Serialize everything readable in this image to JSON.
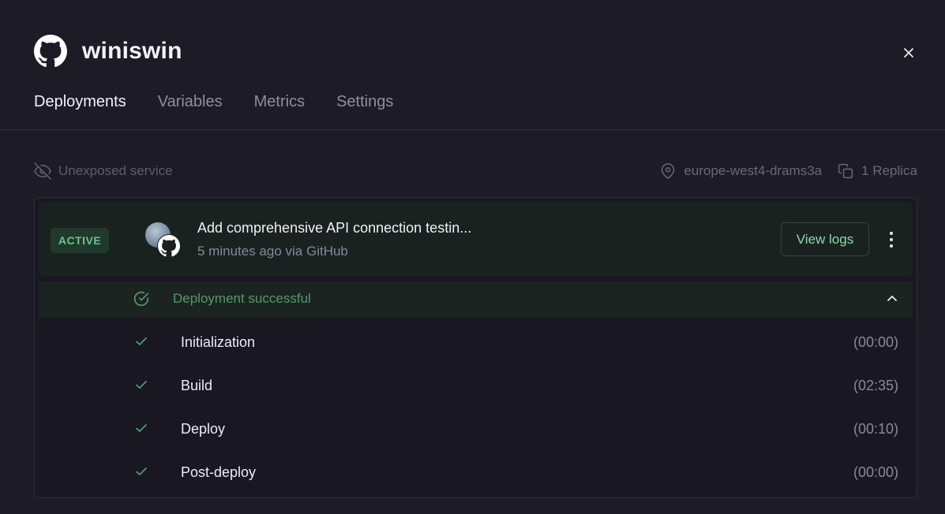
{
  "service": {
    "name": "winiswin"
  },
  "tabs": [
    {
      "label": "Deployments",
      "active": true
    },
    {
      "label": "Variables",
      "active": false
    },
    {
      "label": "Metrics",
      "active": false
    },
    {
      "label": "Settings",
      "active": false
    }
  ],
  "meta": {
    "exposure": "Unexposed service",
    "region": "europe-west4-drams3a",
    "replicas": "1 Replica"
  },
  "deployment": {
    "status_badge": "ACTIVE",
    "commit_message": "Add comprehensive API connection testin...",
    "subtitle": "5 minutes ago via GitHub",
    "view_logs_label": "View logs",
    "result": "Deployment successful",
    "steps": [
      {
        "label": "Initialization",
        "duration": "(00:00)"
      },
      {
        "label": "Build",
        "duration": "(02:35)"
      },
      {
        "label": "Deploy",
        "duration": "(00:10)"
      },
      {
        "label": "Post-deploy",
        "duration": "(00:00)"
      }
    ]
  },
  "colors": {
    "background": "#1c1b26",
    "success": "#4e9d6a",
    "badge_bg": "#21392d",
    "badge_text": "#68c68b"
  },
  "icons": {
    "logo": "github-icon",
    "close": "close-icon",
    "exposure": "eye-off-icon",
    "region": "map-pin-icon",
    "replicas": "copy-icon",
    "status": "check-circle-icon",
    "collapse": "chevron-up-icon",
    "step": "check-icon",
    "menu": "kebab-menu-icon"
  }
}
